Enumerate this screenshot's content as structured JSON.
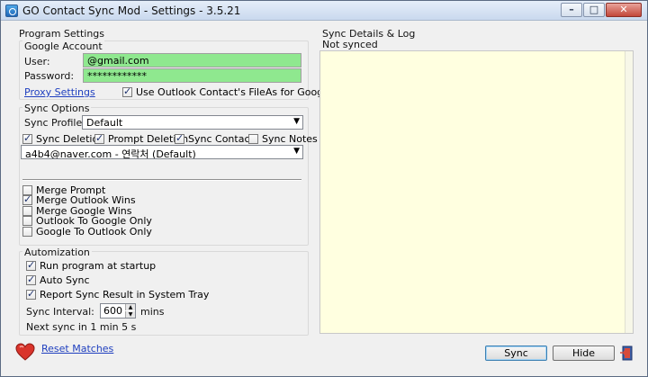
{
  "window": {
    "title": "GO Contact Sync Mod - Settings - 3.5.21",
    "buttons": {
      "minimize": "–",
      "maximize": "□",
      "close": "✕"
    }
  },
  "program_settings": {
    "label": "Program Settings",
    "google_account": {
      "label": "Google Account",
      "user_label": "User:",
      "user_value": "            @gmail.com",
      "password_label": "Password:",
      "password_value": "************",
      "proxy_link": "Proxy Settings",
      "use_fileas_label": "Use Outlook Contact's FileAs for Google Title",
      "use_fileas_checked": true
    },
    "sync_options": {
      "label": "Sync Options",
      "profile_label": "Sync Profile:",
      "profile_value": "Default",
      "checks": [
        {
          "label": "Sync Deletion",
          "checked": true
        },
        {
          "label": "Prompt Deletion",
          "checked": true
        },
        {
          "label": "Sync Contacts",
          "checked": true
        },
        {
          "label": "Sync Notes",
          "checked": false
        }
      ],
      "folder_value": "a4b4@naver.com - 연락처 (Default)",
      "merge_options": [
        {
          "label": "Merge Prompt",
          "checked": false
        },
        {
          "label": "Merge Outlook Wins",
          "checked": true
        },
        {
          "label": "Merge Google Wins",
          "checked": false
        },
        {
          "label": "Outlook To Google Only",
          "checked": false
        },
        {
          "label": "Google To Outlook Only",
          "checked": false
        }
      ]
    },
    "automization": {
      "label": "Automization",
      "options": [
        {
          "label": "Run program at startup",
          "checked": true
        },
        {
          "label": "Auto Sync",
          "checked": true
        },
        {
          "label": "Report Sync Result in System Tray",
          "checked": true
        }
      ],
      "interval_label": "Sync Interval:",
      "interval_value": "600",
      "interval_unit": "mins",
      "next_sync": "Next sync in 1 min 5 s"
    }
  },
  "sync_log": {
    "label": "Sync Details & Log",
    "status": "Not synced"
  },
  "footer": {
    "reset_link": "Reset Matches",
    "sync_button": "Sync",
    "hide_button": "Hide"
  },
  "colors": {
    "field_green": "#8fe88f",
    "log_background": "#ffffe0",
    "link": "#1f3fbf"
  }
}
